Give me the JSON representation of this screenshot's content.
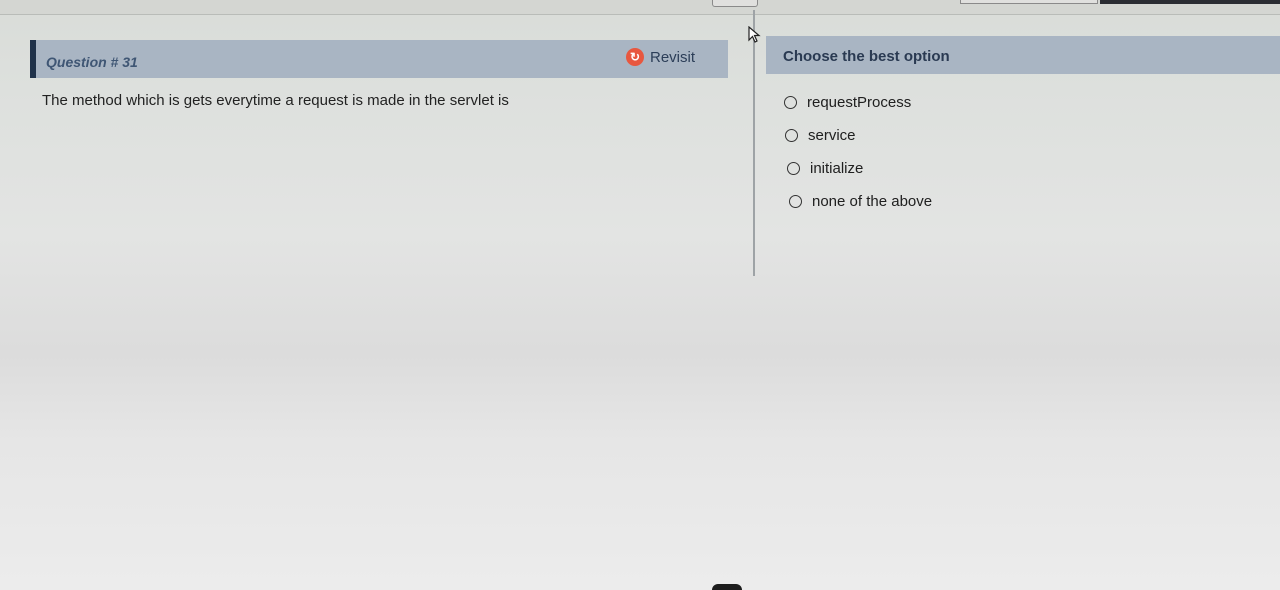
{
  "question": {
    "title": "Question # 31",
    "text": "The  method which is gets everytime a request is made in the servlet is",
    "revisit_label": "Revisit",
    "revisit_icon": "revisit-icon",
    "accent_color": "#e8573f"
  },
  "options_panel": {
    "title": "Choose the best option",
    "options": [
      {
        "label": "requestProcess",
        "selected": false
      },
      {
        "label": "service",
        "selected": false
      },
      {
        "label": "initialize",
        "selected": false
      },
      {
        "label": "none of the above",
        "selected": false
      }
    ]
  },
  "colors": {
    "header_bar": "#a9b5c3",
    "header_accent": "#20324a"
  }
}
